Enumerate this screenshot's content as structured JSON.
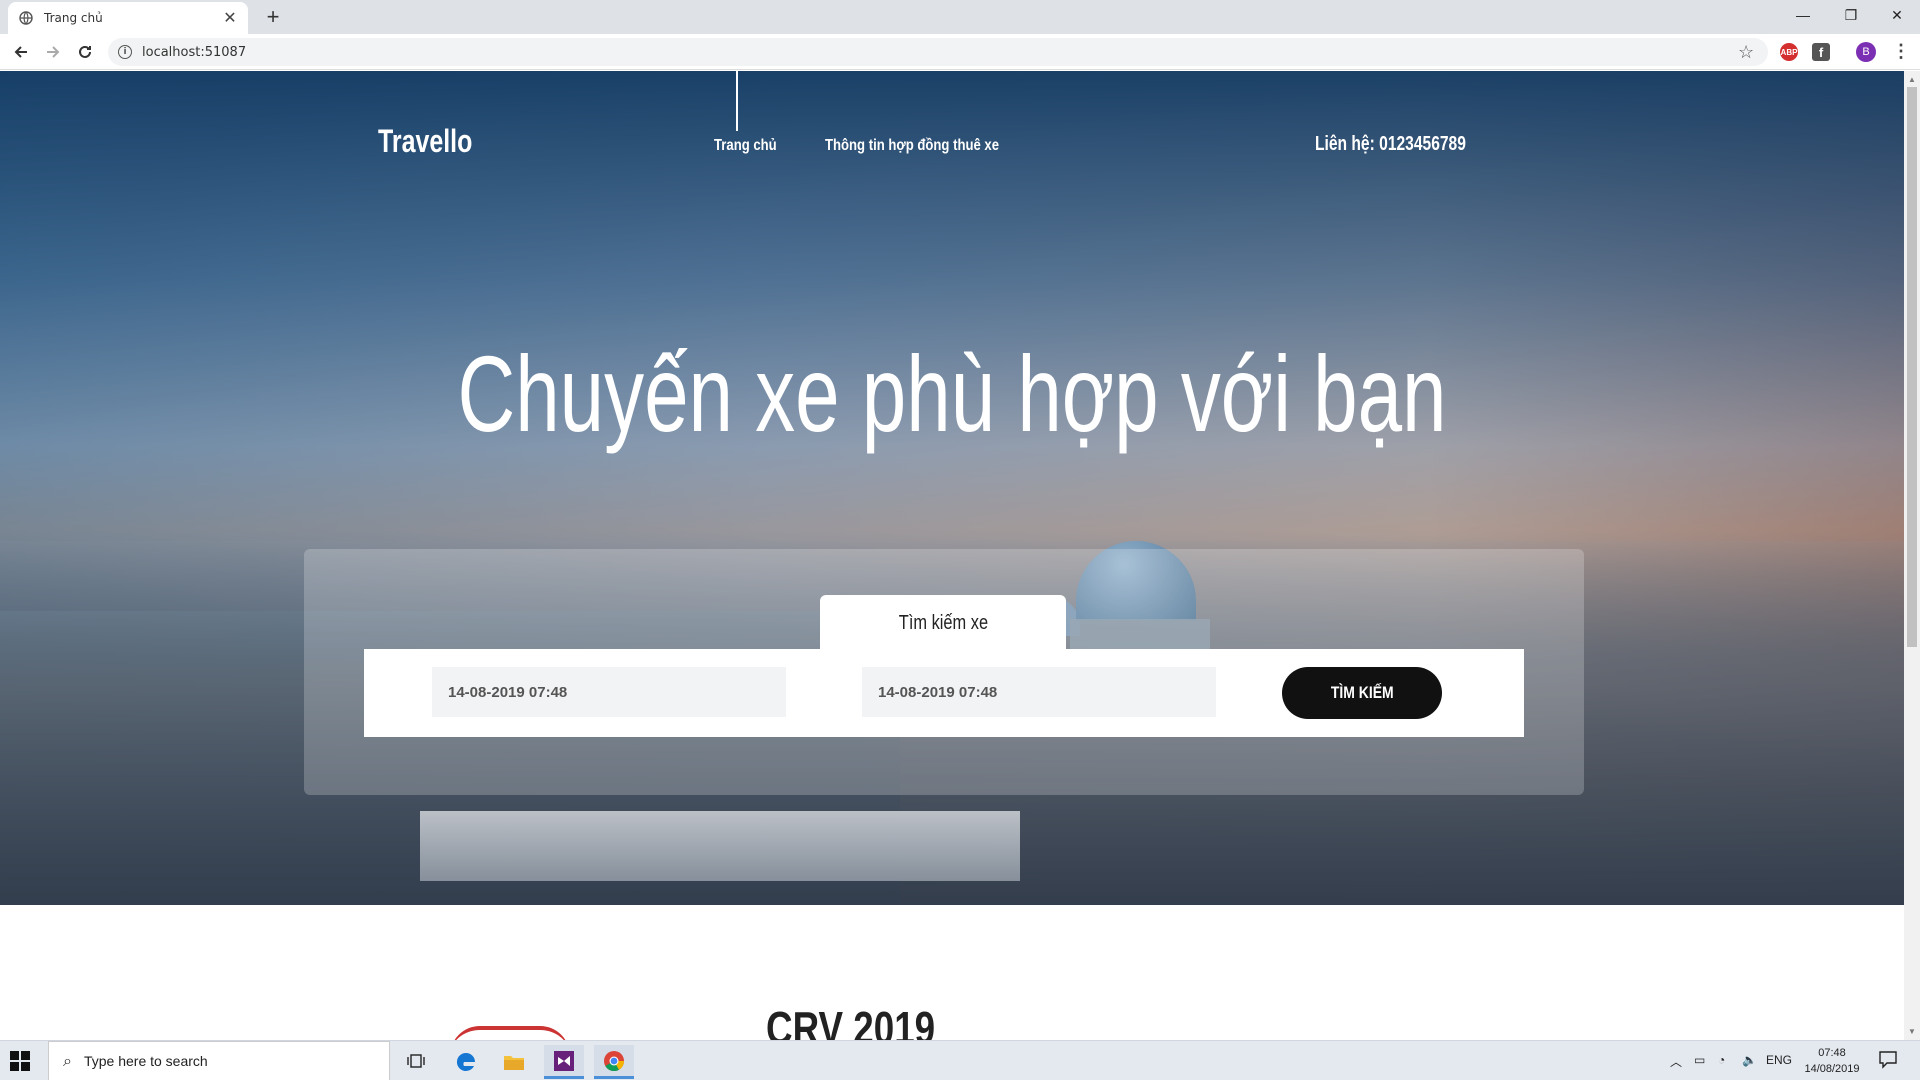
{
  "browser": {
    "tab_title": "Trang chủ",
    "tab_close": "✕",
    "new_tab": "+",
    "url": "localhost:51087",
    "url_info": "i",
    "bookmark": "☆",
    "abp": "ABP",
    "fb": "f",
    "profile_initial": "B",
    "menu": "⋮",
    "win_min": "—",
    "win_restore": "❐",
    "win_close": "✕"
  },
  "site": {
    "brand": "Travello",
    "nav": [
      {
        "label": "Trang chủ"
      },
      {
        "label": "Thông tin hợp đồng thuê xe"
      }
    ],
    "contact": "Liên hệ: 0123456789",
    "headline": "Chuyến xe phù hợp với bạn",
    "search": {
      "tab_label": "Tìm kiếm xe",
      "date_from": "14-08-2019 07:48",
      "date_to": "14-08-2019 07:48",
      "button": "TÌM KIẾM"
    },
    "section_title": "CRV 2019"
  },
  "taskbar": {
    "search_placeholder": "Type here to search",
    "language": "ENG",
    "time": "07:48",
    "date": "14/08/2019"
  },
  "colors": {
    "accent_button": "#111111",
    "profile": "#7b2fb3"
  }
}
